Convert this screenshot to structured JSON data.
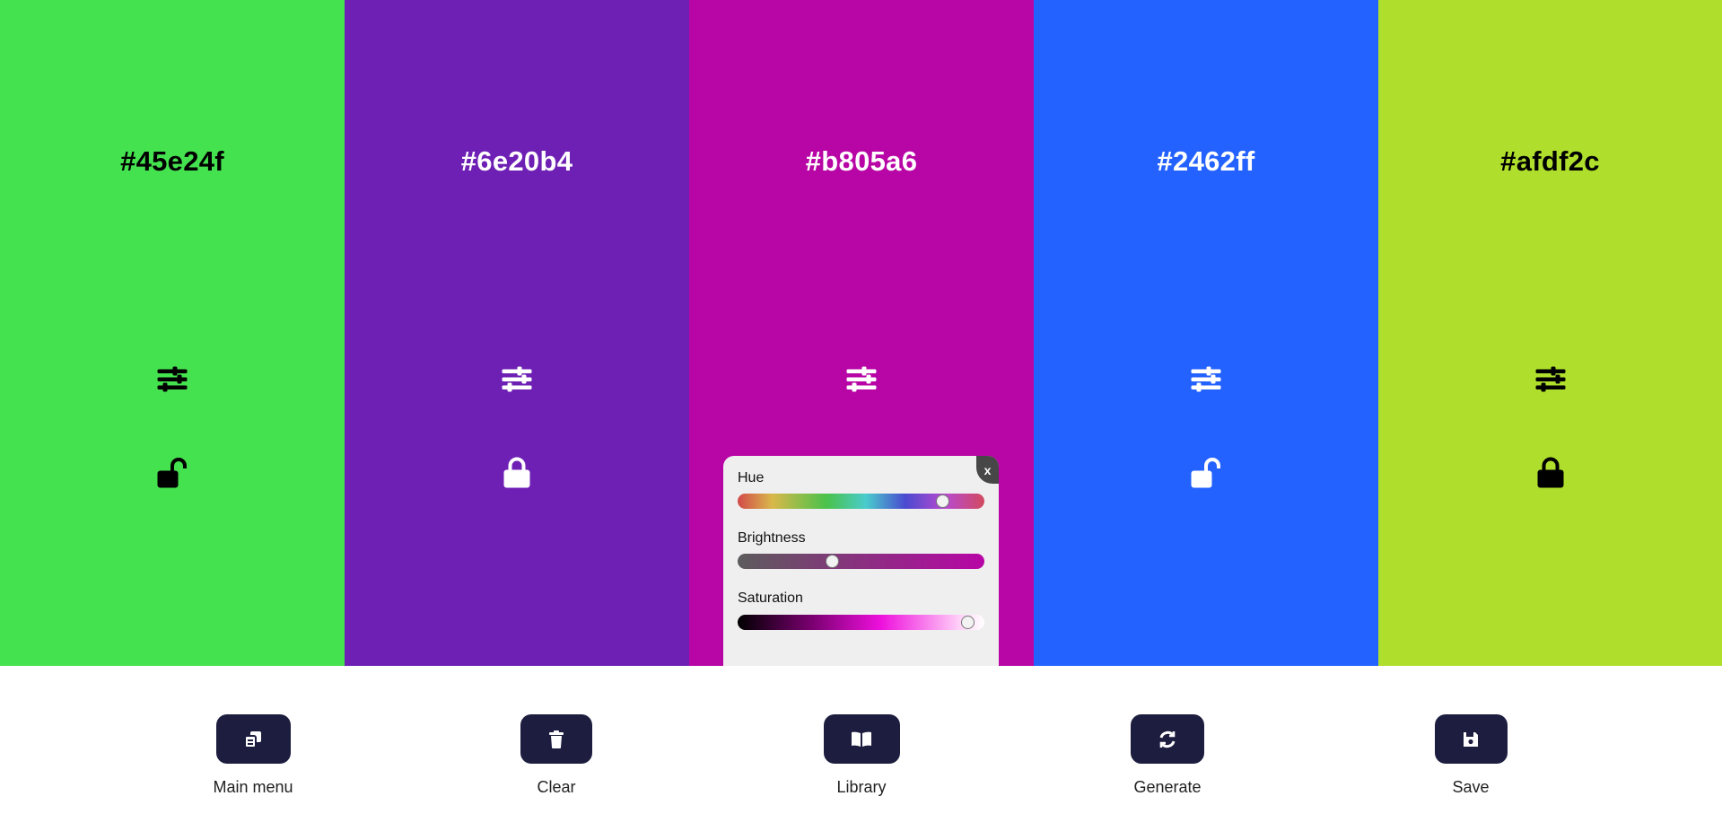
{
  "colors": [
    {
      "hex": "#45e24f",
      "text_color": "#000000",
      "locked": false
    },
    {
      "hex": "#6e20b4",
      "text_color": "#ffffff",
      "locked": true
    },
    {
      "hex": "#b805a6",
      "text_color": "#ffffff",
      "locked": false
    },
    {
      "hex": "#2462ff",
      "text_color": "#ffffff",
      "locked": false
    },
    {
      "hex": "#afdf2c",
      "text_color": "#000000",
      "locked": true
    }
  ],
  "adjust_popup": {
    "close_label": "x",
    "hue_label": "Hue",
    "hue_value": 0.83,
    "brightness_label": "Brightness",
    "brightness_value": 0.38,
    "saturation_label": "Saturation",
    "saturation_value": 0.93
  },
  "toolbar": {
    "button_bg": "#1d1d3f",
    "main_menu_label": "Main menu",
    "clear_label": "Clear",
    "library_label": "Library",
    "generate_label": "Generate",
    "save_label": "Save"
  }
}
